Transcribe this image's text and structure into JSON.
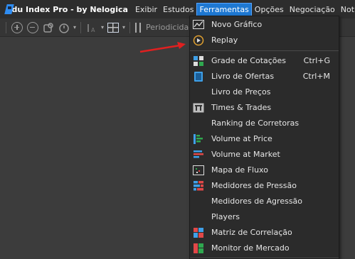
{
  "app": {
    "title": "Edu Index Pro - by Nelogica"
  },
  "menubar": {
    "items": [
      "Exibir",
      "Estudos",
      "Ferramentas",
      "Opções",
      "Negociação",
      "Notícias"
    ],
    "active": "Ferramentas"
  },
  "toolbar": {
    "icons": [
      "zoom-in-icon",
      "zoom-out-icon",
      "pan-icon",
      "timer-icon",
      "text-size-icon",
      "layout-grid-icon",
      "sliders-icon"
    ],
    "periodicidade_label": "Periodicidad"
  },
  "dropdown": {
    "items": [
      {
        "label": "Novo Gráfico",
        "icon": "chart-icon",
        "shortcut": ""
      },
      {
        "label": "Replay",
        "icon": "replay-icon",
        "shortcut": ""
      },
      {
        "label": "Grade de Cotações",
        "icon": "quote-grid-icon",
        "shortcut": "Ctrl+G"
      },
      {
        "label": "Livro de Ofertas",
        "icon": "order-book-icon",
        "shortcut": "Ctrl+M"
      },
      {
        "label": "Livro de Preços",
        "icon": "",
        "shortcut": ""
      },
      {
        "label": "Times & Trades",
        "icon": "times-trades-icon",
        "shortcut": ""
      },
      {
        "label": "Ranking de Corretoras",
        "icon": "",
        "shortcut": ""
      },
      {
        "label": "Volume at Price",
        "icon": "volume-at-price-icon",
        "shortcut": ""
      },
      {
        "label": "Volume at Market",
        "icon": "volume-at-market-icon",
        "shortcut": ""
      },
      {
        "label": "Mapa de Fluxo",
        "icon": "flow-map-icon",
        "shortcut": ""
      },
      {
        "label": "Medidores de Pressão",
        "icon": "pressure-gauge-icon",
        "shortcut": ""
      },
      {
        "label": "Medidores de Agressão",
        "icon": "",
        "shortcut": ""
      },
      {
        "label": "Players",
        "icon": "",
        "shortcut": ""
      },
      {
        "label": "Matriz de Correlação",
        "icon": "correlation-matrix-icon",
        "shortcut": ""
      },
      {
        "label": "Monitor de Mercado",
        "icon": "market-monitor-icon",
        "shortcut": ""
      }
    ]
  },
  "colors": {
    "menubar_bg": "#2d2d2d",
    "active_menu": "#1e78d2",
    "dropdown_bg": "#2b2b2b",
    "workspace_bg": "#3c3c3c",
    "annotation_arrow": "#e02020"
  }
}
